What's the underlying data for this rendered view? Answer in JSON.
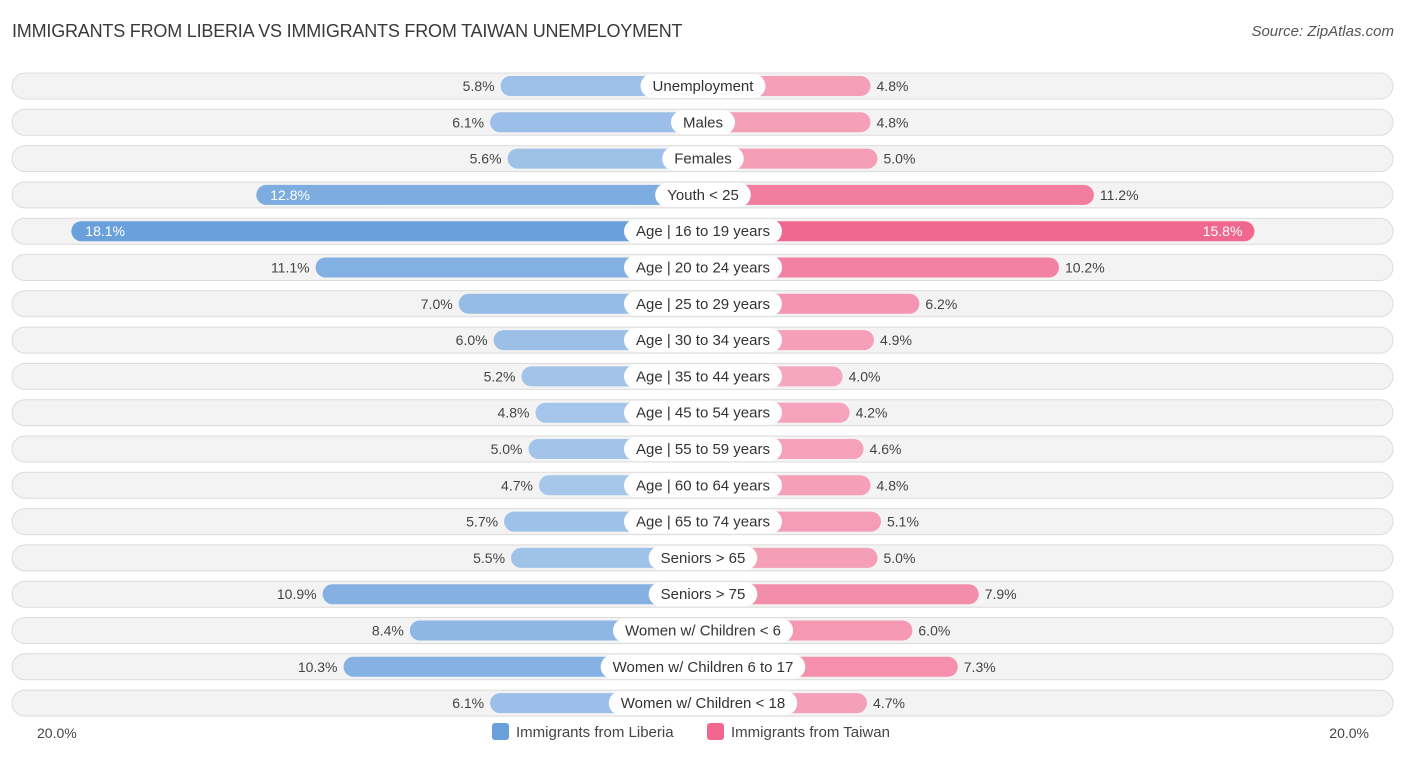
{
  "chart_data": {
    "type": "bar",
    "orientation": "horizontal-diverging",
    "title": "IMMIGRANTS FROM LIBERIA VS IMMIGRANTS FROM TAIWAN UNEMPLOYMENT",
    "source": "Source: ZipAtlas.com",
    "categories": [
      "Unemployment",
      "Males",
      "Females",
      "Youth < 25",
      "Age | 16 to 19 years",
      "Age | 20 to 24 years",
      "Age | 25 to 29 years",
      "Age | 30 to 34 years",
      "Age | 35 to 44 years",
      "Age | 45 to 54 years",
      "Age | 55 to 59 years",
      "Age | 60 to 64 years",
      "Age | 65 to 74 years",
      "Seniors > 65",
      "Seniors > 75",
      "Women w/ Children < 6",
      "Women w/ Children 6 to 17",
      "Women w/ Children < 18"
    ],
    "series": [
      {
        "name": "Immigrants from Liberia",
        "side": "left",
        "color": "#6aa0dc",
        "color_light": "#a9c8eb",
        "values": [
          5.8,
          6.1,
          5.6,
          12.8,
          18.1,
          11.1,
          7.0,
          6.0,
          5.2,
          4.8,
          5.0,
          4.7,
          5.7,
          5.5,
          10.9,
          8.4,
          10.3,
          6.1
        ]
      },
      {
        "name": "Immigrants from Taiwan",
        "side": "right",
        "color": "#f06890",
        "color_light": "#f6a8c0",
        "values": [
          4.8,
          4.8,
          5.0,
          11.2,
          15.8,
          10.2,
          6.2,
          4.9,
          4.0,
          4.2,
          4.6,
          4.8,
          5.1,
          5.0,
          7.9,
          6.0,
          7.3,
          4.7
        ]
      }
    ],
    "value_suffix": "%",
    "xlim": [
      0,
      20.0
    ],
    "axis_labels": {
      "left": "20.0%",
      "right": "20.0%"
    },
    "legend_position": "bottom-center",
    "grid": false
  }
}
